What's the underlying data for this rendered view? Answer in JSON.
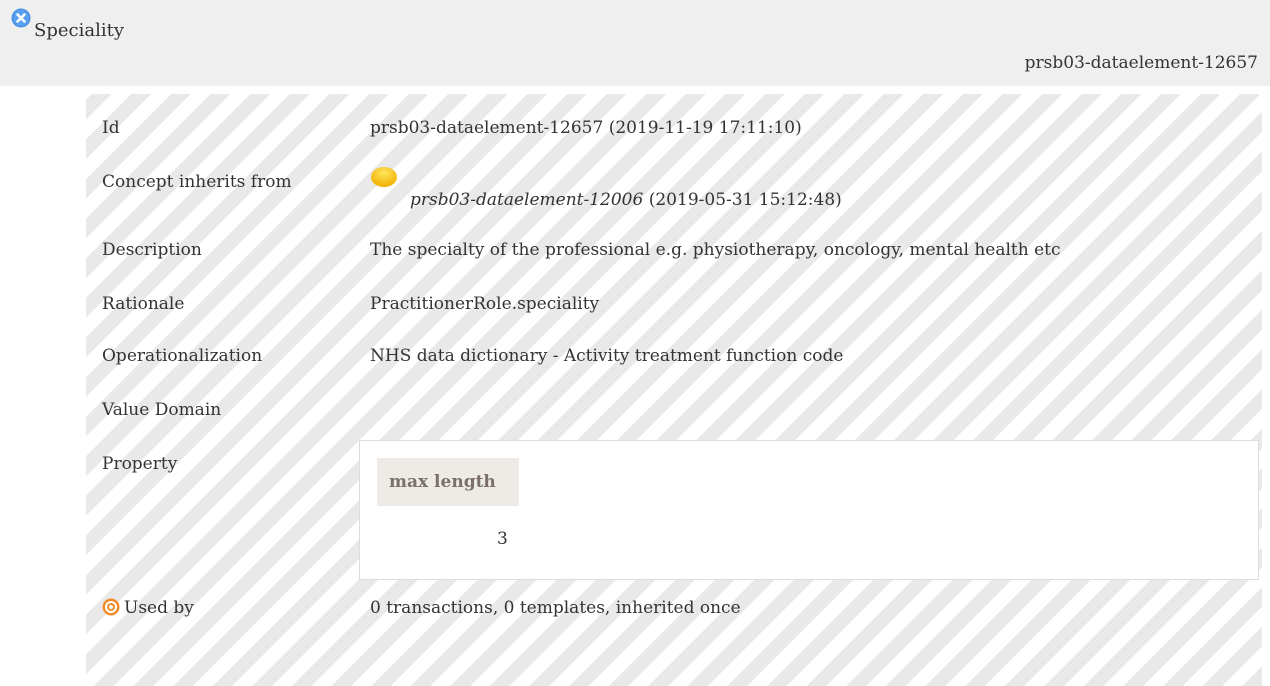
{
  "header": {
    "title": "Speciality",
    "id": "prsb03-dataelement-12657"
  },
  "rows": {
    "id": {
      "label": "Id",
      "value": "prsb03-dataelement-12657 (2019-11-19 17:11:10)"
    },
    "inherits": {
      "label": "Concept inherits from",
      "link": "prsb03-dataelement-12006",
      "date": "(2019-05-31 15:12:48)"
    },
    "description": {
      "label": "Description",
      "value": "The specialty of the professional e.g. physiotherapy, oncology, mental health etc"
    },
    "rationale": {
      "label": "Rationale",
      "value": "PractitionerRole.speciality"
    },
    "operationalization": {
      "label": "Operationalization",
      "value": "NHS data dictionary - Activity treatment function code"
    },
    "value_domain": {
      "label": "Value Domain"
    },
    "property": {
      "label": "Property",
      "column_header": "max length",
      "column_value": "3"
    },
    "used_by": {
      "label": "Used by",
      "value": "0 transactions, 0 templates, inherited once"
    }
  },
  "icons": {
    "close": "close-circle-icon",
    "status": "status-dot-icon",
    "used_by": "target-icon"
  },
  "colors": {
    "close_icon": "#4a90e2",
    "status_dot": "#f5c400",
    "used_by_icon": "#f08c2a"
  }
}
